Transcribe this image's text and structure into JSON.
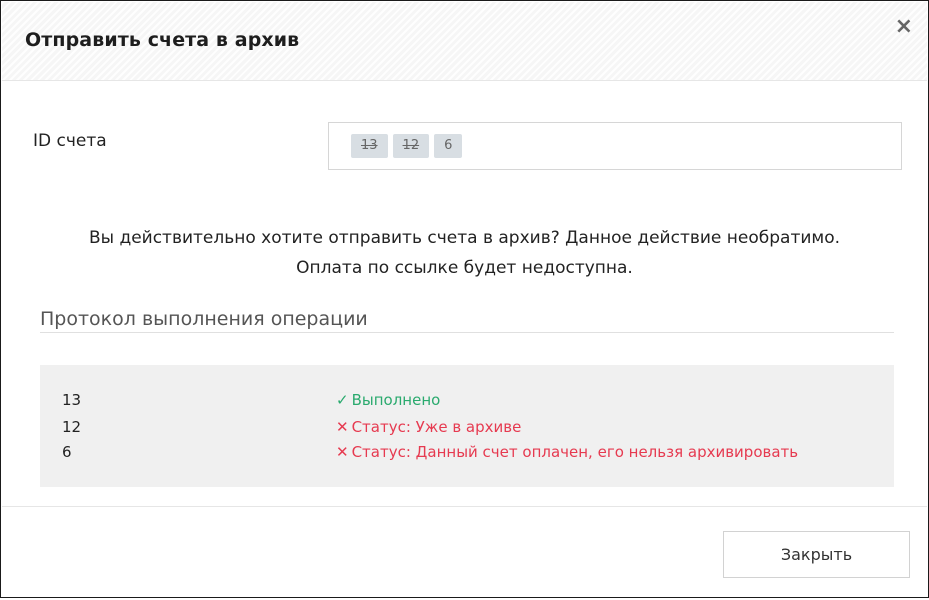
{
  "dialog": {
    "title": "Отправить счета в архив",
    "close_glyph": "×"
  },
  "form": {
    "id_label": "ID счета",
    "tags": [
      {
        "label": "13",
        "struck": true
      },
      {
        "label": "12",
        "struck": true
      },
      {
        "label": "6",
        "struck": false
      }
    ]
  },
  "message": {
    "line1": "Вы действительно хотите отправить счета в архив? Данное действие необратимо.",
    "line2": "Оплата по ссылке будет недоступна."
  },
  "log": {
    "title": "Протокол выполнения операции",
    "rows": [
      {
        "id": "13",
        "icon": "✓",
        "status": "Выполнено",
        "kind": "success"
      },
      {
        "id": "12",
        "icon": "✕",
        "status": "Статус: Уже в архиве",
        "kind": "error"
      },
      {
        "id": "6",
        "icon": "✕",
        "status": "Статус: Данный счет оплачен, его нельзя архивировать",
        "kind": "error"
      }
    ]
  },
  "footer": {
    "close_label": "Закрыть"
  },
  "colors": {
    "success": "#2aaa6e",
    "error": "#e63a50"
  }
}
